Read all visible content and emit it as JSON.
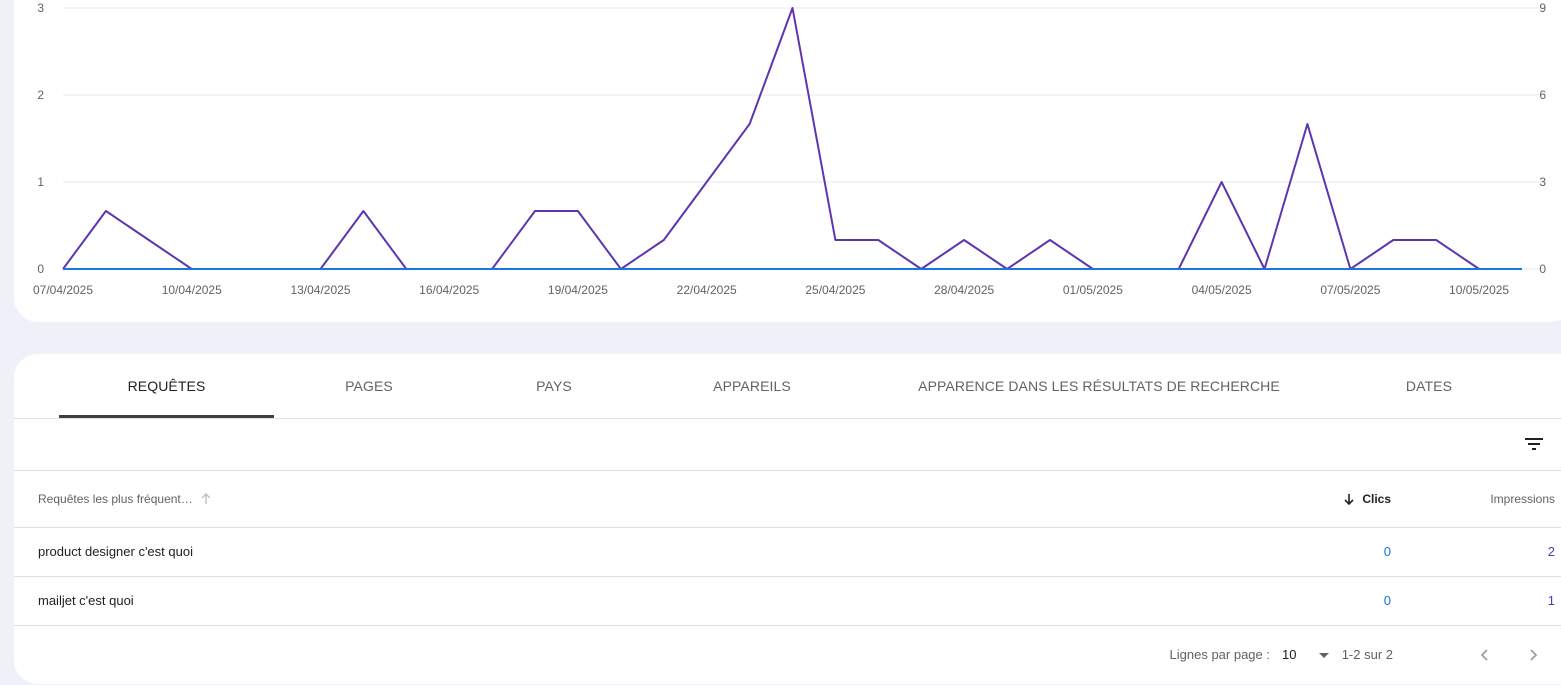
{
  "chart_data": {
    "type": "line",
    "x": [
      "07/04/2025",
      "08/04/2025",
      "09/04/2025",
      "10/04/2025",
      "11/04/2025",
      "12/04/2025",
      "13/04/2025",
      "14/04/2025",
      "15/04/2025",
      "16/04/2025",
      "17/04/2025",
      "18/04/2025",
      "19/04/2025",
      "20/04/2025",
      "21/04/2025",
      "22/04/2025",
      "23/04/2025",
      "24/04/2025",
      "25/04/2025",
      "26/04/2025",
      "27/04/2025",
      "28/04/2025",
      "29/04/2025",
      "30/04/2025",
      "01/05/2025",
      "02/05/2025",
      "03/05/2025",
      "04/05/2025",
      "05/05/2025",
      "06/05/2025",
      "07/05/2025",
      "08/05/2025",
      "09/05/2025",
      "10/05/2025",
      "11/05/2025"
    ],
    "xticks": [
      "07/04/2025",
      "10/04/2025",
      "13/04/2025",
      "16/04/2025",
      "19/04/2025",
      "22/04/2025",
      "25/04/2025",
      "28/04/2025",
      "01/05/2025",
      "04/05/2025",
      "07/05/2025",
      "10/05/2025"
    ],
    "series": [
      {
        "name": "Clics",
        "axis": "left",
        "color": "#1a73e8",
        "values": [
          0,
          0,
          0,
          0,
          0,
          0,
          0,
          0,
          0,
          0,
          0,
          0,
          0,
          0,
          0,
          0,
          0,
          0,
          0,
          0,
          0,
          0,
          0,
          0,
          0,
          0,
          0,
          0,
          0,
          0,
          0,
          0,
          0,
          0,
          0
        ]
      },
      {
        "name": "Impressions",
        "axis": "right",
        "color": "#5e35b1",
        "values": [
          0,
          2,
          1,
          0,
          0,
          0,
          0,
          2,
          0,
          0,
          0,
          2,
          2,
          0,
          1,
          3,
          5,
          9,
          1,
          1,
          0,
          1,
          0,
          1,
          0,
          0,
          0,
          3,
          0,
          5,
          0,
          1,
          1,
          0,
          0
        ]
      }
    ],
    "left_ticks": [
      "0",
      "1",
      "2",
      "3"
    ],
    "right_ticks": [
      "0",
      "3",
      "6",
      "9"
    ],
    "ylim_left": [
      0,
      3
    ],
    "ylim_right": [
      0,
      9
    ],
    "grid": true
  },
  "tabs": [
    {
      "label": "REQUÊTES",
      "active": true
    },
    {
      "label": "PAGES",
      "active": false
    },
    {
      "label": "PAYS",
      "active": false
    },
    {
      "label": "APPAREILS",
      "active": false
    },
    {
      "label": "APPARENCE DANS LES RÉSULTATS DE RECHERCHE",
      "active": false
    },
    {
      "label": "DATES",
      "active": false
    }
  ],
  "table": {
    "columns": {
      "query": "Requêtes les plus fréquent…",
      "clicks": "Clics",
      "impressions": "Impressions"
    },
    "rows": [
      {
        "query": "product designer c'est quoi",
        "clicks": "0",
        "impressions": "2"
      },
      {
        "query": "mailjet c'est quoi",
        "clicks": "0",
        "impressions": "1"
      }
    ]
  },
  "pagination": {
    "rows_per_page_label": "Lignes par page :",
    "rows_per_page_value": "10",
    "range": "1-2 sur 2"
  },
  "colors": {
    "clicks": "#1a73e8",
    "impressions": "#5e35b1",
    "background": "#eef1f8"
  },
  "icons": [
    "filter-icon",
    "sort-up-icon",
    "sort-down-icon",
    "dropdown-icon",
    "chevron-left-icon",
    "chevron-right-icon"
  ]
}
